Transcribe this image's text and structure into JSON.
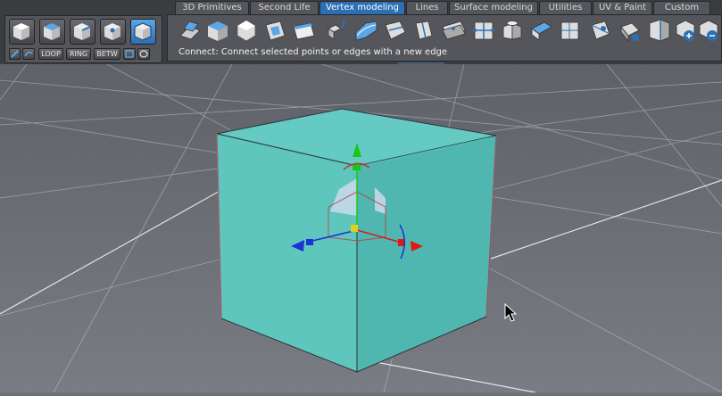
{
  "tabs": [
    {
      "label": "3D Primitives",
      "active": false
    },
    {
      "label": "Second Life",
      "active": false
    },
    {
      "label": "Vertex modeling",
      "active": true
    },
    {
      "label": "Lines",
      "active": false
    },
    {
      "label": "Surface modeling",
      "active": false
    },
    {
      "label": "Utilities",
      "active": false
    },
    {
      "label": "UV & Paint",
      "active": false
    },
    {
      "label": "Custom",
      "active": false
    }
  ],
  "selection_modes": [
    {
      "name": "object-mode-icon"
    },
    {
      "name": "face-mode-icon"
    },
    {
      "name": "edge-mode-icon"
    },
    {
      "name": "vertex-mode-icon"
    },
    {
      "name": "all-mode-icon",
      "active": true
    }
  ],
  "selection_tools": {
    "loop": "LOOP",
    "ring": "RING",
    "betw": "BETW"
  },
  "tools": [
    {
      "name": "extrude-icon"
    },
    {
      "name": "bevel-icon"
    },
    {
      "name": "smooth-icon"
    },
    {
      "name": "inset-icon"
    },
    {
      "name": "shell-icon"
    },
    {
      "name": "extrude-path-icon"
    },
    {
      "name": "sweep-icon"
    },
    {
      "name": "lathe-icon"
    },
    {
      "name": "knife-icon"
    },
    {
      "name": "slice-icon"
    },
    {
      "name": "connect-icon"
    },
    {
      "name": "weld-icon"
    },
    {
      "name": "split-icon"
    },
    {
      "name": "subdivide-icon"
    },
    {
      "name": "triangulate-icon"
    },
    {
      "name": "tessellate-icon"
    },
    {
      "name": "flip-icon"
    },
    {
      "name": "sculpt-icon"
    },
    {
      "name": "add-point-icon"
    },
    {
      "name": "remove-point-icon"
    }
  ],
  "status_text": "Connect: Connect selected points or edges with a new edge",
  "colors": {
    "accent": "#2c6fb4",
    "cube": "#5ec9c1",
    "axis_x": "#e01818",
    "axis_y": "#18c818",
    "axis_z": "#1a33d6",
    "grid": "#d8dade"
  }
}
